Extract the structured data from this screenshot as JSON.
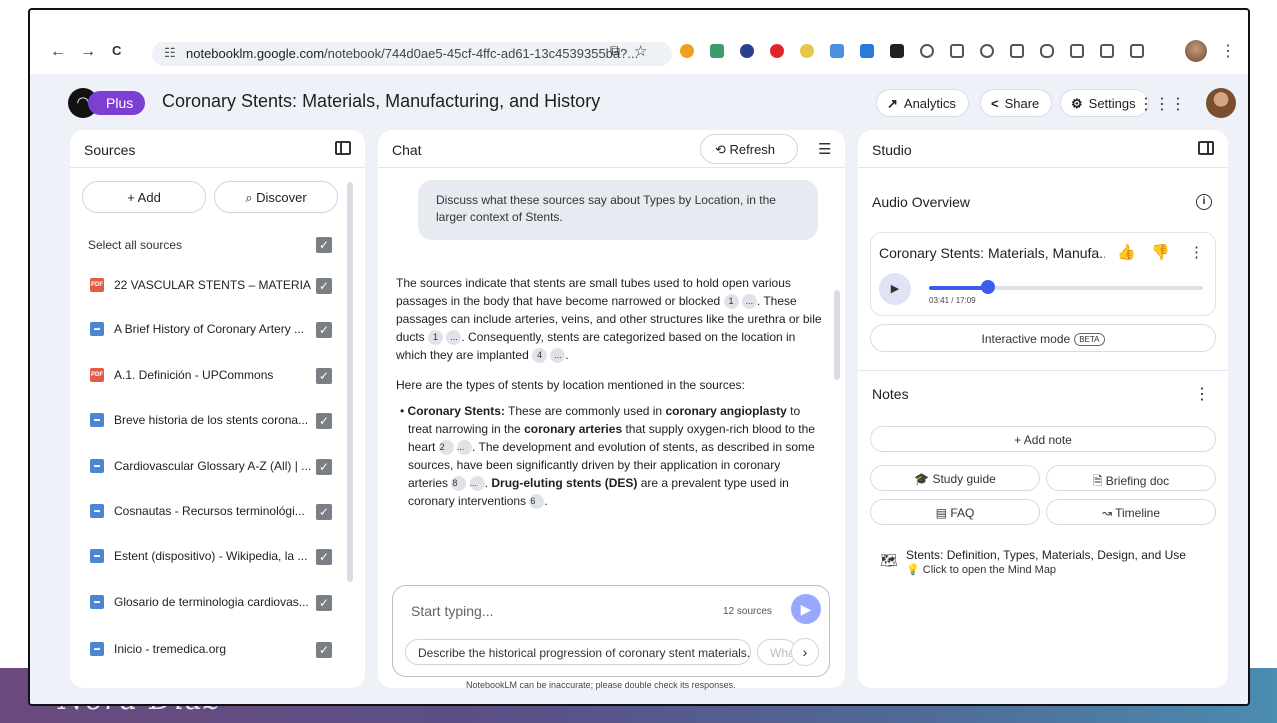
{
  "browser": {
    "url_host": "notebooklm.google.com",
    "url_path": "/notebook/744d0ae5-45cf-4ffc-ad61-13c4539355ba?...",
    "nav": {
      "back": "←",
      "forward": "→",
      "reload": "C"
    }
  },
  "header": {
    "plan_label": "Plus",
    "notebook_title": "Coronary Stents: Materials, Manufacturing, and History",
    "analytics_label": "Analytics",
    "share_label": "Share",
    "settings_label": "Settings"
  },
  "sources": {
    "title": "Sources",
    "add_label": "+ Add",
    "discover_label": "Discover",
    "select_all_label": "Select all sources",
    "items": [
      {
        "type": "PDF",
        "label": "22 VASCULAR STENTS – MATERIAL..."
      },
      {
        "type": "web",
        "label": "A Brief History of Coronary Artery ..."
      },
      {
        "type": "PDF",
        "label": "A.1. Definición - UPCommons"
      },
      {
        "type": "web",
        "label": "Breve historia de los stents corona..."
      },
      {
        "type": "web",
        "label": "Cardiovascular Glossary A-Z (All) | ..."
      },
      {
        "type": "web",
        "label": "Cosnautas - Recursos terminológi..."
      },
      {
        "type": "web",
        "label": "Estent (dispositivo) - Wikipedia, la ..."
      },
      {
        "type": "web",
        "label": "Glosario de terminologia cardiovas..."
      },
      {
        "type": "web",
        "label": "Inicio - tremedica.org"
      }
    ]
  },
  "chat": {
    "title": "Chat",
    "refresh_label": "Refresh",
    "user_message": "Discuss what these sources say about Types by Location, in the larger context of Stents.",
    "response": {
      "p1_a": "The sources indicate that stents are small tubes used to hold open various passages in the body that have become narrowed or blocked ",
      "p1_c1": "1",
      "p1_c2": "...",
      "p1_b": ". These passages can include arteries, veins, and other structures like the urethra or bile ducts ",
      "p1_c3": "1",
      "p1_c4": "...",
      "p1_c": ". Consequently, stents are categorized based on the location in which they are implanted ",
      "p1_c5": "4",
      "p1_c6": "...",
      "p1_d": ".",
      "p2": "Here are the types of stents by location mentioned in the sources:",
      "b1_bold1": "Coronary Stents:",
      "b1_a": " These are commonly used in ",
      "b1_bold2": "coronary angioplasty",
      "b1_b": " to treat narrowing in the ",
      "b1_bold3": "coronary arteries",
      "b1_c": " that supply oxygen-rich blood to the heart ",
      "b1_c1": "2",
      "b1_c2": "...",
      "b1_d": ". The development and evolution of stents, as described in some sources, have been significantly driven by their application in coronary arteries ",
      "b1_c3": "8",
      "b1_c4": "...",
      "b1_e": ". ",
      "b1_bold4": "Drug-eluting stents (DES)",
      "b1_f": " are a prevalent type used in coronary interventions ",
      "b1_c5": "6",
      "b1_g": "."
    },
    "composer_placeholder": "Start typing...",
    "source_count": "12 sources",
    "suggestions": [
      "Describe the historical progression of coronary stent materials.",
      "Wha"
    ],
    "disclaimer": "NotebookLM can be inaccurate; please double check its responses."
  },
  "studio": {
    "title": "Studio",
    "audio_overview_label": "Audio Overview",
    "audio_title": "Coronary Stents: Materials, Manufa...",
    "time": "03:41 / 17:09",
    "progress": 0.215,
    "interactive_label": "Interactive mode",
    "beta_label": "BETA",
    "notes_label": "Notes",
    "add_note_label": "+ Add note",
    "study_guide_label": "Study guide",
    "briefing_doc_label": "Briefing doc",
    "faq_label": "FAQ",
    "timeline_label": "Timeline",
    "mindmap_title": "Stents: Definition, Types, Materials, Design, and Use",
    "mindmap_sub": "Click to open the Mind Map"
  },
  "slide": {
    "signature": "Nora Díaz"
  },
  "colors": {
    "accent": "#3e5cf0",
    "plus_pill": "#7c3fd1",
    "pdf_icon": "#e35b45",
    "web_icon": "#4a86d4"
  }
}
